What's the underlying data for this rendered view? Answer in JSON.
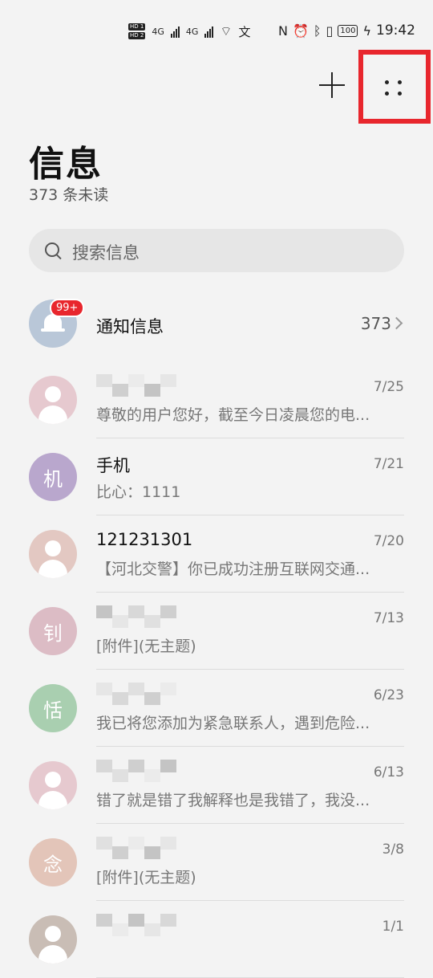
{
  "status": {
    "time": "19:42",
    "battery": "100",
    "network": "4G",
    "icons": [
      "hd1-icon",
      "signal-icon",
      "wifi-icon",
      "nfc-icon",
      "alarm-icon",
      "bluetooth-icon",
      "vibrate-icon",
      "charging-icon"
    ]
  },
  "toolbar": {
    "add_icon": "plus-icon",
    "more_icon": "more-dots-icon"
  },
  "header": {
    "title": "信息",
    "unread": "373 条未读"
  },
  "search": {
    "placeholder": "搜索信息"
  },
  "notification": {
    "name": "通知信息",
    "count": "373",
    "badge": "99+"
  },
  "conversations": [
    {
      "avatar_text": "",
      "avatar_color": "#e6c9cf",
      "name": "",
      "date": "7/25",
      "preview": "尊敬的用户您好，截至今日凌晨您的电..."
    },
    {
      "avatar_text": "机",
      "avatar_color": "#b9a7cd",
      "name": "手机",
      "date": "7/21",
      "preview": "比心：1111"
    },
    {
      "avatar_text": "",
      "avatar_color": "#e3c8c2",
      "name": "121231301",
      "date": "7/20",
      "preview": "【河北交警】你已成功注册互联网交通..."
    },
    {
      "avatar_text": "钊",
      "avatar_color": "#dcbcc5",
      "name": "",
      "date": "7/13",
      "preview": "[附件](无主题)"
    },
    {
      "avatar_text": "恬",
      "avatar_color": "#a9cfb0",
      "name": "",
      "date": "6/23",
      "preview": "我已将您添加为紧急联系人，遇到危险..."
    },
    {
      "avatar_text": "",
      "avatar_color": "#e6c9cf",
      "name": "",
      "date": "6/13",
      "preview": "错了就是错了我解释也是我错了，我没..."
    },
    {
      "avatar_text": "念",
      "avatar_color": "#e3c5b9",
      "name": "",
      "date": "3/8",
      "preview": "[附件](无主题)"
    },
    {
      "avatar_text": "",
      "avatar_color": "#c9bdb5",
      "name": "",
      "date": "1/1",
      "preview": ""
    }
  ]
}
